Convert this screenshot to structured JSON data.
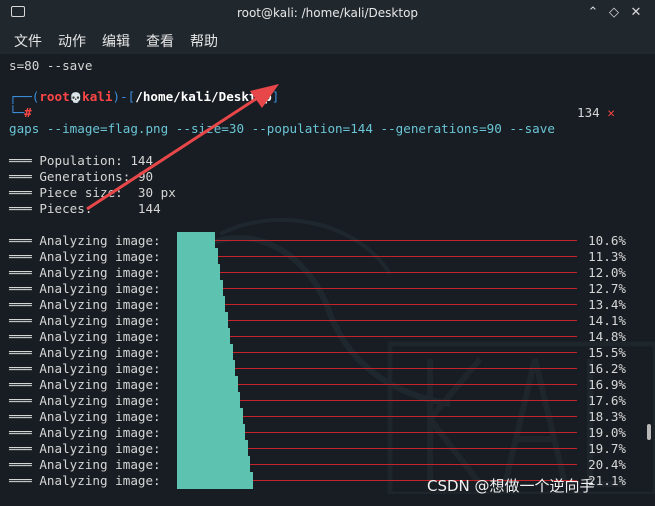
{
  "window": {
    "title": "root@kali: /home/kali/Desktop",
    "min_glyph": "⌃",
    "restore_glyph": "◇",
    "close_glyph": "✕"
  },
  "menu": [
    "文件",
    "动作",
    "编辑",
    "查看",
    "帮助"
  ],
  "terminal": {
    "prev_line": "s=80 --save",
    "prompt_user": "root",
    "prompt_skull": "💀",
    "prompt_host": "kali",
    "prompt_path": "/home/kali/Desktop",
    "prompt_symbol": "#",
    "right_status": "134",
    "right_status_mark": "✕",
    "command": "gaps --image=flag.png --size=30 --population=144 --generations=90 --save",
    "info": [
      {
        "label": "Population:",
        "value": "144"
      },
      {
        "label": "Generations:",
        "value": "90"
      },
      {
        "label": "Piece size:",
        "value": "30 px"
      },
      {
        "label": "Pieces:",
        "value": "144"
      }
    ],
    "analyzing_label": "Analyzing image:",
    "progress": [
      {
        "percent": 10.6,
        "text": "10.6%"
      },
      {
        "percent": 11.3,
        "text": "11.3%"
      },
      {
        "percent": 12.0,
        "text": "12.0%"
      },
      {
        "percent": 12.7,
        "text": "12.7%"
      },
      {
        "percent": 13.4,
        "text": "13.4%"
      },
      {
        "percent": 14.1,
        "text": "14.1%"
      },
      {
        "percent": 14.8,
        "text": "14.8%"
      },
      {
        "percent": 15.5,
        "text": "15.5%"
      },
      {
        "percent": 16.2,
        "text": "16.2%"
      },
      {
        "percent": 16.9,
        "text": "16.9%"
      },
      {
        "percent": 17.6,
        "text": "17.6%"
      },
      {
        "percent": 18.3,
        "text": "18.3%"
      },
      {
        "percent": 19.0,
        "text": "19.0%"
      },
      {
        "percent": 19.7,
        "text": "19.7%"
      },
      {
        "percent": 20.4,
        "text": "20.4%"
      },
      {
        "percent": 21.1,
        "text": "21.1%"
      }
    ]
  },
  "overlay": {
    "watermark_text": "CSDN @想做一个逆向手"
  }
}
